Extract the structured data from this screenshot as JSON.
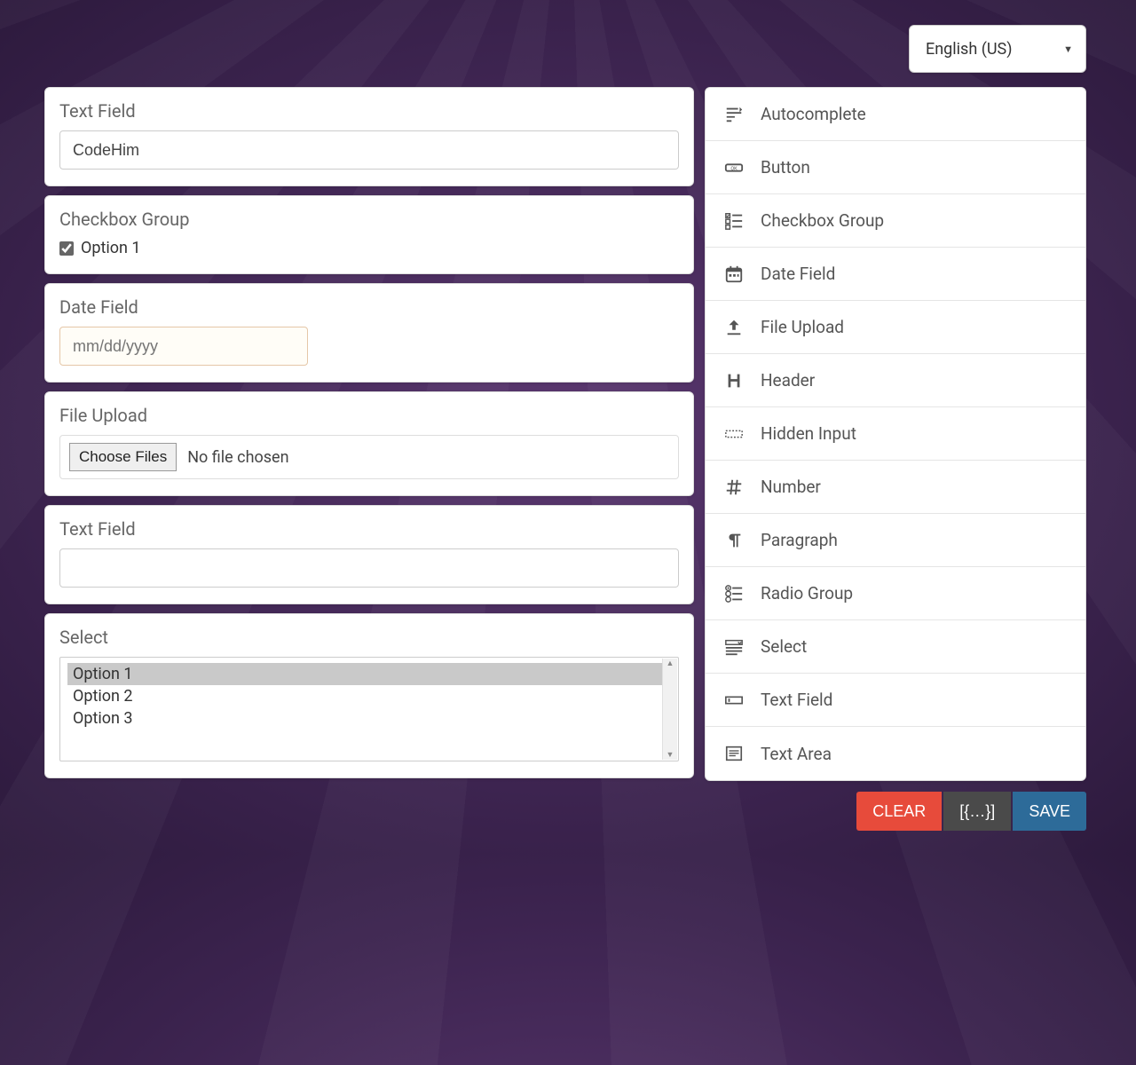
{
  "language": {
    "selected": "English (US)"
  },
  "canvas": {
    "items": [
      {
        "type": "text",
        "label": "Text Field",
        "value": "CodeHim"
      },
      {
        "type": "checkbox",
        "label": "Checkbox Group",
        "option_label": "Option 1",
        "checked": true
      },
      {
        "type": "date",
        "label": "Date Field",
        "placeholder": "mm/dd/yyyy"
      },
      {
        "type": "file",
        "label": "File Upload",
        "button_label": "Choose Files",
        "status_text": "No file chosen"
      },
      {
        "type": "text",
        "label": "Text Field",
        "value": ""
      },
      {
        "type": "select",
        "label": "Select",
        "options": [
          "Option 1",
          "Option 2",
          "Option 3"
        ],
        "selected_index": 0
      }
    ]
  },
  "palette": {
    "items": [
      {
        "icon": "autocomplete",
        "label": "Autocomplete"
      },
      {
        "icon": "button",
        "label": "Button"
      },
      {
        "icon": "checkbox",
        "label": "Checkbox Group"
      },
      {
        "icon": "date",
        "label": "Date Field"
      },
      {
        "icon": "upload",
        "label": "File Upload"
      },
      {
        "icon": "header",
        "label": "Header"
      },
      {
        "icon": "hidden",
        "label": "Hidden Input"
      },
      {
        "icon": "number",
        "label": "Number"
      },
      {
        "icon": "paragraph",
        "label": "Paragraph"
      },
      {
        "icon": "radio",
        "label": "Radio Group"
      },
      {
        "icon": "select",
        "label": "Select"
      },
      {
        "icon": "textfield",
        "label": "Text Field"
      },
      {
        "icon": "textarea",
        "label": "Text Area"
      }
    ]
  },
  "actions": {
    "clear_label": "CLEAR",
    "json_label": "[{…}]",
    "save_label": "SAVE"
  }
}
